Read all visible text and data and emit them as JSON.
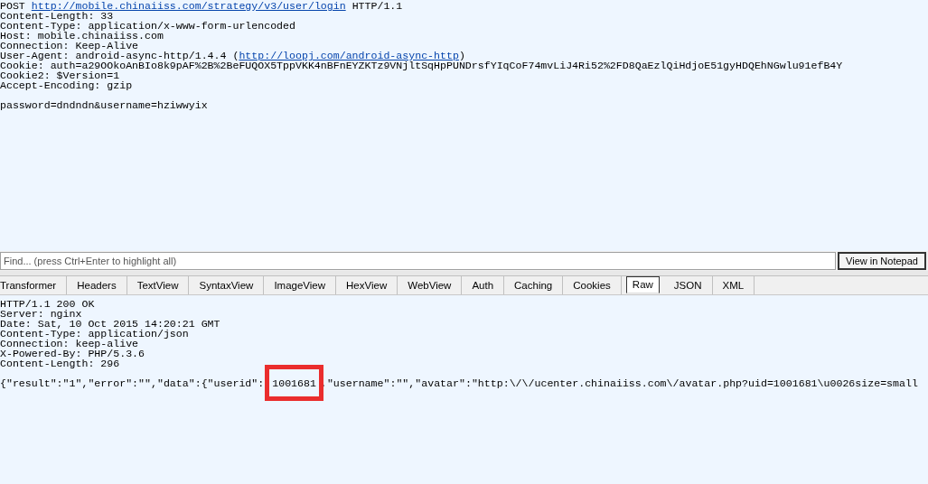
{
  "request": {
    "lines": [
      {
        "parts": [
          {
            "text": "POST "
          },
          {
            "text": "http://mobile.chinaiiss.com/strategy/v3/user/login",
            "kind": "link"
          },
          {
            "text": " HTTP/1.1"
          }
        ]
      },
      {
        "parts": [
          {
            "text": "Content-Length: 33"
          }
        ]
      },
      {
        "parts": [
          {
            "text": "Content-Type: application/x-www-form-urlencoded"
          }
        ]
      },
      {
        "parts": [
          {
            "text": "Host: mobile.chinaiiss.com"
          }
        ]
      },
      {
        "parts": [
          {
            "text": "Connection: Keep-Alive"
          }
        ]
      },
      {
        "parts": [
          {
            "text": "User-Agent: android-async-http/1.4.4 ("
          },
          {
            "text": "http://loopj.com/android-async-http",
            "kind": "link"
          },
          {
            "text": ")"
          }
        ]
      },
      {
        "parts": [
          {
            "text": "Cookie: auth=a29OOkoAnBIo8k9pAF%2B%2BeFUQOX5TppVKK4nBFnEYZKTz9VNjltSqHpPUNDrsfYIqCoF74mvLiJ4Ri52%2FD8QaEzlQiHdjoE51gyHDQEhNGwlu91efB4Y"
          }
        ]
      },
      {
        "parts": [
          {
            "text": "Cookie2: $Version=1"
          }
        ]
      },
      {
        "parts": [
          {
            "text": "Accept-Encoding: gzip"
          }
        ]
      }
    ],
    "body": "password=dndndn&username=hziwwyix"
  },
  "find": {
    "placeholder": "Find... (press Ctrl+Enter to highlight all)",
    "button": "View in Notepad"
  },
  "tabs": [
    {
      "label": "Transformer",
      "selected": false
    },
    {
      "label": "Headers",
      "selected": false
    },
    {
      "label": "TextView",
      "selected": false
    },
    {
      "label": "SyntaxView",
      "selected": false
    },
    {
      "label": "ImageView",
      "selected": false
    },
    {
      "label": "HexView",
      "selected": false
    },
    {
      "label": "WebView",
      "selected": false
    },
    {
      "label": "Auth",
      "selected": false
    },
    {
      "label": "Caching",
      "selected": false
    },
    {
      "label": "Cookies",
      "selected": false
    },
    {
      "label": "Raw",
      "selected": true
    },
    {
      "label": "JSON",
      "selected": false
    },
    {
      "label": "XML",
      "selected": false
    }
  ],
  "response": {
    "lines": [
      "HTTP/1.1 200 OK",
      "Server: nginx",
      "Date: Sat, 10 Oct 2015 14:20:21 GMT",
      "Content-Type: application/json",
      "Connection: keep-alive",
      "X-Powered-By: PHP/5.3.6",
      "Content-Length: 296"
    ],
    "body": [
      {
        "text": "{\"result\":\"1\",\"error\":\"\",\"data\":{\"userid\":",
        "highlighted": false
      },
      {
        "text": "1001681",
        "highlighted": true
      },
      {
        "text": ",\"username\":\"\",\"avatar\":\"http:\\/\\/ucenter.chinaiiss.com\\/avatar.php?uid=1001681\\u0026size=small",
        "highlighted": false
      }
    ]
  }
}
